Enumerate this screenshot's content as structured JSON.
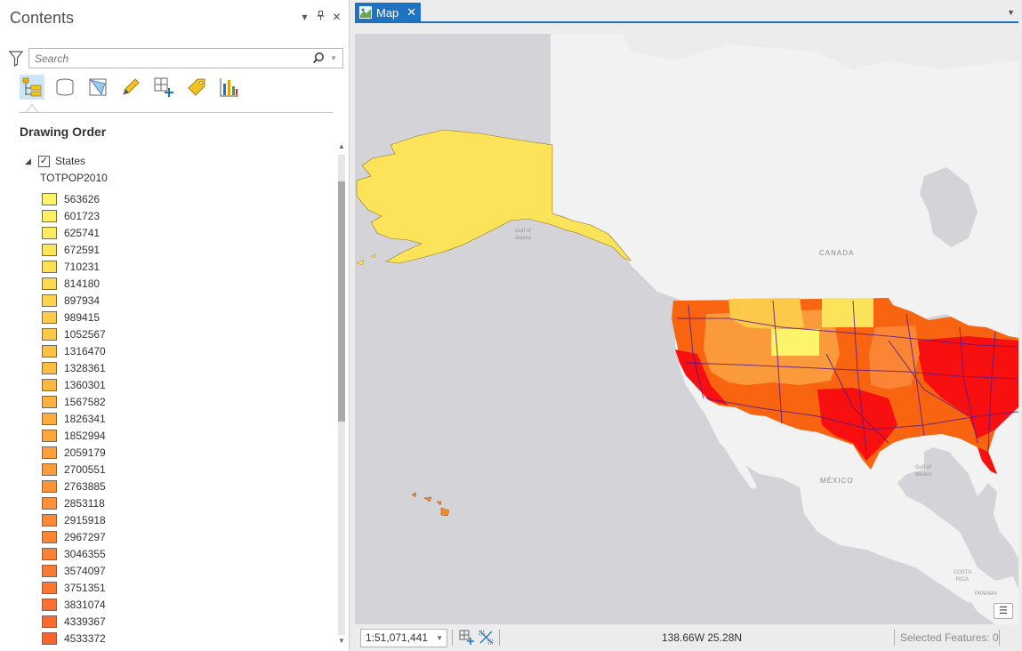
{
  "contents": {
    "title": "Contents",
    "pane_controls": [
      "▾",
      "⊥",
      "✕"
    ],
    "search": {
      "placeholder": "Search",
      "value": ""
    },
    "section_title": "Drawing Order",
    "layer": {
      "name": "States",
      "checked": true,
      "field": "TOTPOP2010"
    },
    "legend": [
      {
        "label": "563626",
        "color": "#fef46a"
      },
      {
        "label": "601723",
        "color": "#fef065"
      },
      {
        "label": "625741",
        "color": "#fdeb60"
      },
      {
        "label": "672591",
        "color": "#fde55b"
      },
      {
        "label": "710231",
        "color": "#fde057"
      },
      {
        "label": "814180",
        "color": "#fdda53"
      },
      {
        "label": "897934",
        "color": "#fdd44f"
      },
      {
        "label": "989415",
        "color": "#fdcd4b"
      },
      {
        "label": "1052567",
        "color": "#fdc848"
      },
      {
        "label": "1316470",
        "color": "#fdc245"
      },
      {
        "label": "1328361",
        "color": "#fcbd43"
      },
      {
        "label": "1360301",
        "color": "#fcb741"
      },
      {
        "label": "1567582",
        "color": "#fcb13f"
      },
      {
        "label": "1826341",
        "color": "#fcab3d"
      },
      {
        "label": "1852994",
        "color": "#fca63b"
      },
      {
        "label": "2059179",
        "color": "#fba03a"
      },
      {
        "label": "2700551",
        "color": "#fb9b39"
      },
      {
        "label": "2763885",
        "color": "#fb9538"
      },
      {
        "label": "2853118",
        "color": "#fb9037"
      },
      {
        "label": "2915918",
        "color": "#fa8a36"
      },
      {
        "label": "2967297",
        "color": "#fa8535"
      },
      {
        "label": "3046355",
        "color": "#fa8034"
      },
      {
        "label": "3574097",
        "color": "#f97a33"
      },
      {
        "label": "3751351",
        "color": "#f97532"
      },
      {
        "label": "3831074",
        "color": "#f86f31"
      },
      {
        "label": "4339367",
        "color": "#f86a30"
      },
      {
        "label": "4533372",
        "color": "#f7652f"
      }
    ]
  },
  "map": {
    "tab_label": "Map",
    "labels": {
      "canada": "CANADA",
      "mexico": "MÉXICO",
      "gulf_alaska": "Gulf of Alaska",
      "gulf_mexico": "Gulf of Mexico",
      "costa_rica": "COSTA RICA",
      "panama": "PANAMA"
    },
    "colors": {
      "land": "#f2f2f2",
      "water": "#d4d4d8",
      "alaska": "#fde35a",
      "high": "#f80f0f",
      "roads": "#5a1a8a"
    }
  },
  "status": {
    "scale": "1:51,071,441",
    "coordinates": "138.66W 25.28N",
    "selected_features": "Selected Features: 0"
  }
}
